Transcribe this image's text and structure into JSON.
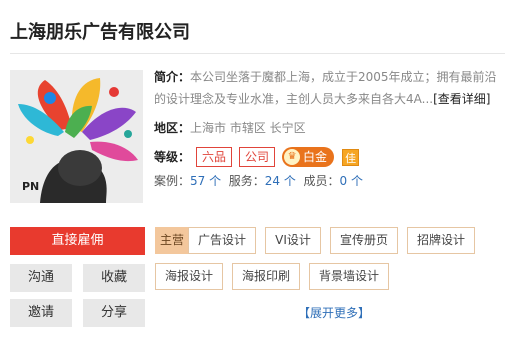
{
  "company": {
    "name": "上海朋乐广告有限公司"
  },
  "intro": {
    "label": "简介：",
    "text": "本公司坐落于魔都上海，成立于2005年成立；拥有最前沿的设计理念及专业水准，主创人员大多来自各大4A...",
    "more_label": "[查看详细]"
  },
  "region": {
    "label": "地区：",
    "value": "上海市 市辖区 长宁区"
  },
  "grade": {
    "label": "等级：",
    "badges": [
      "六品",
      "公司"
    ],
    "gold_label": "白金",
    "jia_label": "佳"
  },
  "stats": {
    "cases_label": "案例：",
    "cases_value": "57",
    "service_label": "服务：",
    "service_value": "24",
    "members_label": "成员：",
    "members_value": "0",
    "unit": " 个"
  },
  "actions": {
    "hire": "直接雇佣",
    "communicate": "沟通",
    "favorite": "收藏",
    "invite": "邀请",
    "share": "分享"
  },
  "services": {
    "main_label": "主营",
    "items": [
      "广告设计",
      "VI设计",
      "宣传册页",
      "招牌设计",
      "海报设计",
      "海报印刷",
      "背景墙设计"
    ],
    "expand_label": "【展开更多】"
  },
  "colors": {
    "accent_red": "#e83a2e",
    "tag_border": "#e6c6a3",
    "main_tag_bg": "#f3c79c",
    "link_blue": "#2f6fb8",
    "gold_badge": "#e9731c"
  }
}
